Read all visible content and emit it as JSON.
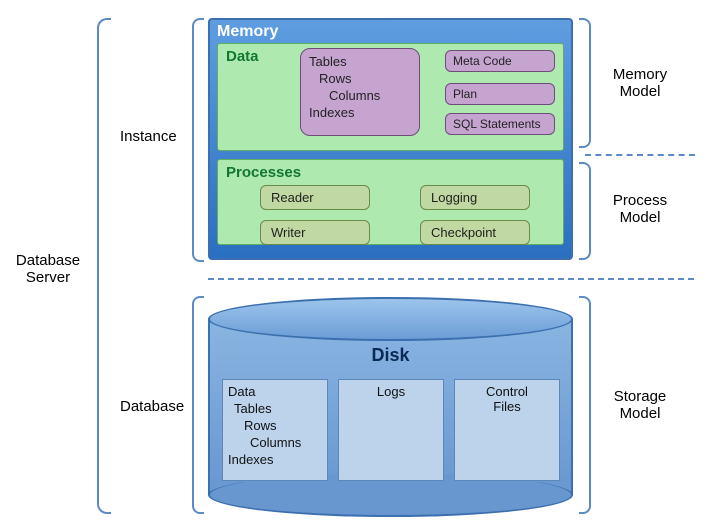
{
  "labels": {
    "server": "Database\nServer",
    "instance": "Instance",
    "database": "Database",
    "memory_model": "Memory\nModel",
    "process_model": "Process\nModel",
    "storage_model": "Storage\nModel"
  },
  "memory": {
    "title": "Memory",
    "data": {
      "title": "Data",
      "tables": {
        "l1": "Tables",
        "l2": "Rows",
        "l3": "Columns",
        "l4": "Indexes"
      },
      "meta": "Meta Code",
      "plan": "Plan",
      "sql": "SQL Statements"
    },
    "processes": {
      "title": "Processes",
      "reader": "Reader",
      "writer": "Writer",
      "logging": "Logging",
      "checkpoint": "Checkpoint"
    }
  },
  "disk": {
    "title": "Disk",
    "data": {
      "l1": "Data",
      "l2": "Tables",
      "l3": "Rows",
      "l4": "Columns",
      "l5": "Indexes"
    },
    "logs": "Logs",
    "ctrl": "Control\nFiles"
  }
}
